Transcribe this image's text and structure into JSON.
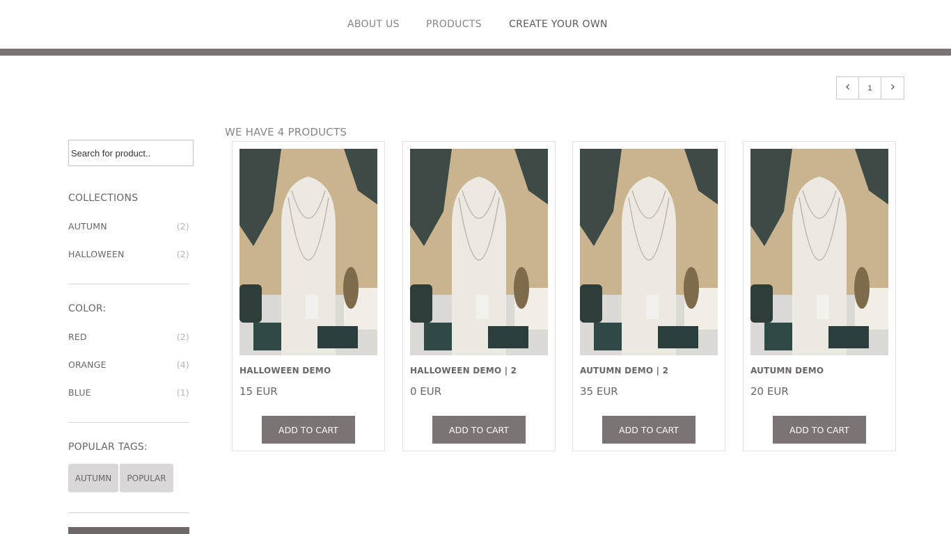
{
  "nav": {
    "items": [
      {
        "label": "ABOUT US"
      },
      {
        "label": "PRODUCTS"
      },
      {
        "label": "CREATE YOUR OWN"
      }
    ]
  },
  "pagination": {
    "current_page": "1",
    "prev_icon": "chevron-left-icon",
    "next_icon": "chevron-right-icon"
  },
  "search": {
    "placeholder": "Search for product.."
  },
  "sidebar": {
    "collections": {
      "heading": "COLLECTIONS",
      "items": [
        {
          "label": "AUTUMN",
          "count": "(2)"
        },
        {
          "label": "HALLOWEEN",
          "count": "(2)"
        }
      ]
    },
    "color": {
      "heading": "COLOR:",
      "items": [
        {
          "label": "RED",
          "count": "(2)"
        },
        {
          "label": "ORANGE",
          "count": "(4)"
        },
        {
          "label": "BLUE",
          "count": "(1)"
        }
      ]
    },
    "tags": {
      "heading": "POPULAR TAGS:",
      "items": [
        {
          "label": "AUTUMN"
        },
        {
          "label": "POPULAR"
        }
      ]
    }
  },
  "products": {
    "count_text": "WE HAVE 4 PRODUCTS",
    "items": [
      {
        "name": "HALLOWEEN DEMO",
        "price": "15 EUR",
        "button": "ADD TO CART"
      },
      {
        "name": "HALLOWEEN DEMO | 2",
        "price": "0 EUR",
        "button": "ADD TO CART"
      },
      {
        "name": "AUTUMN DEMO | 2",
        "price": "35 EUR",
        "button": "ADD TO CART"
      },
      {
        "name": "AUTUMN DEMO",
        "price": "20 EUR",
        "button": "ADD TO CART"
      }
    ]
  },
  "colors": {
    "accent": "#7b7474",
    "text": "#6b6565",
    "muted": "#b9b4b4",
    "tag_bg": "#d9d7d7"
  }
}
